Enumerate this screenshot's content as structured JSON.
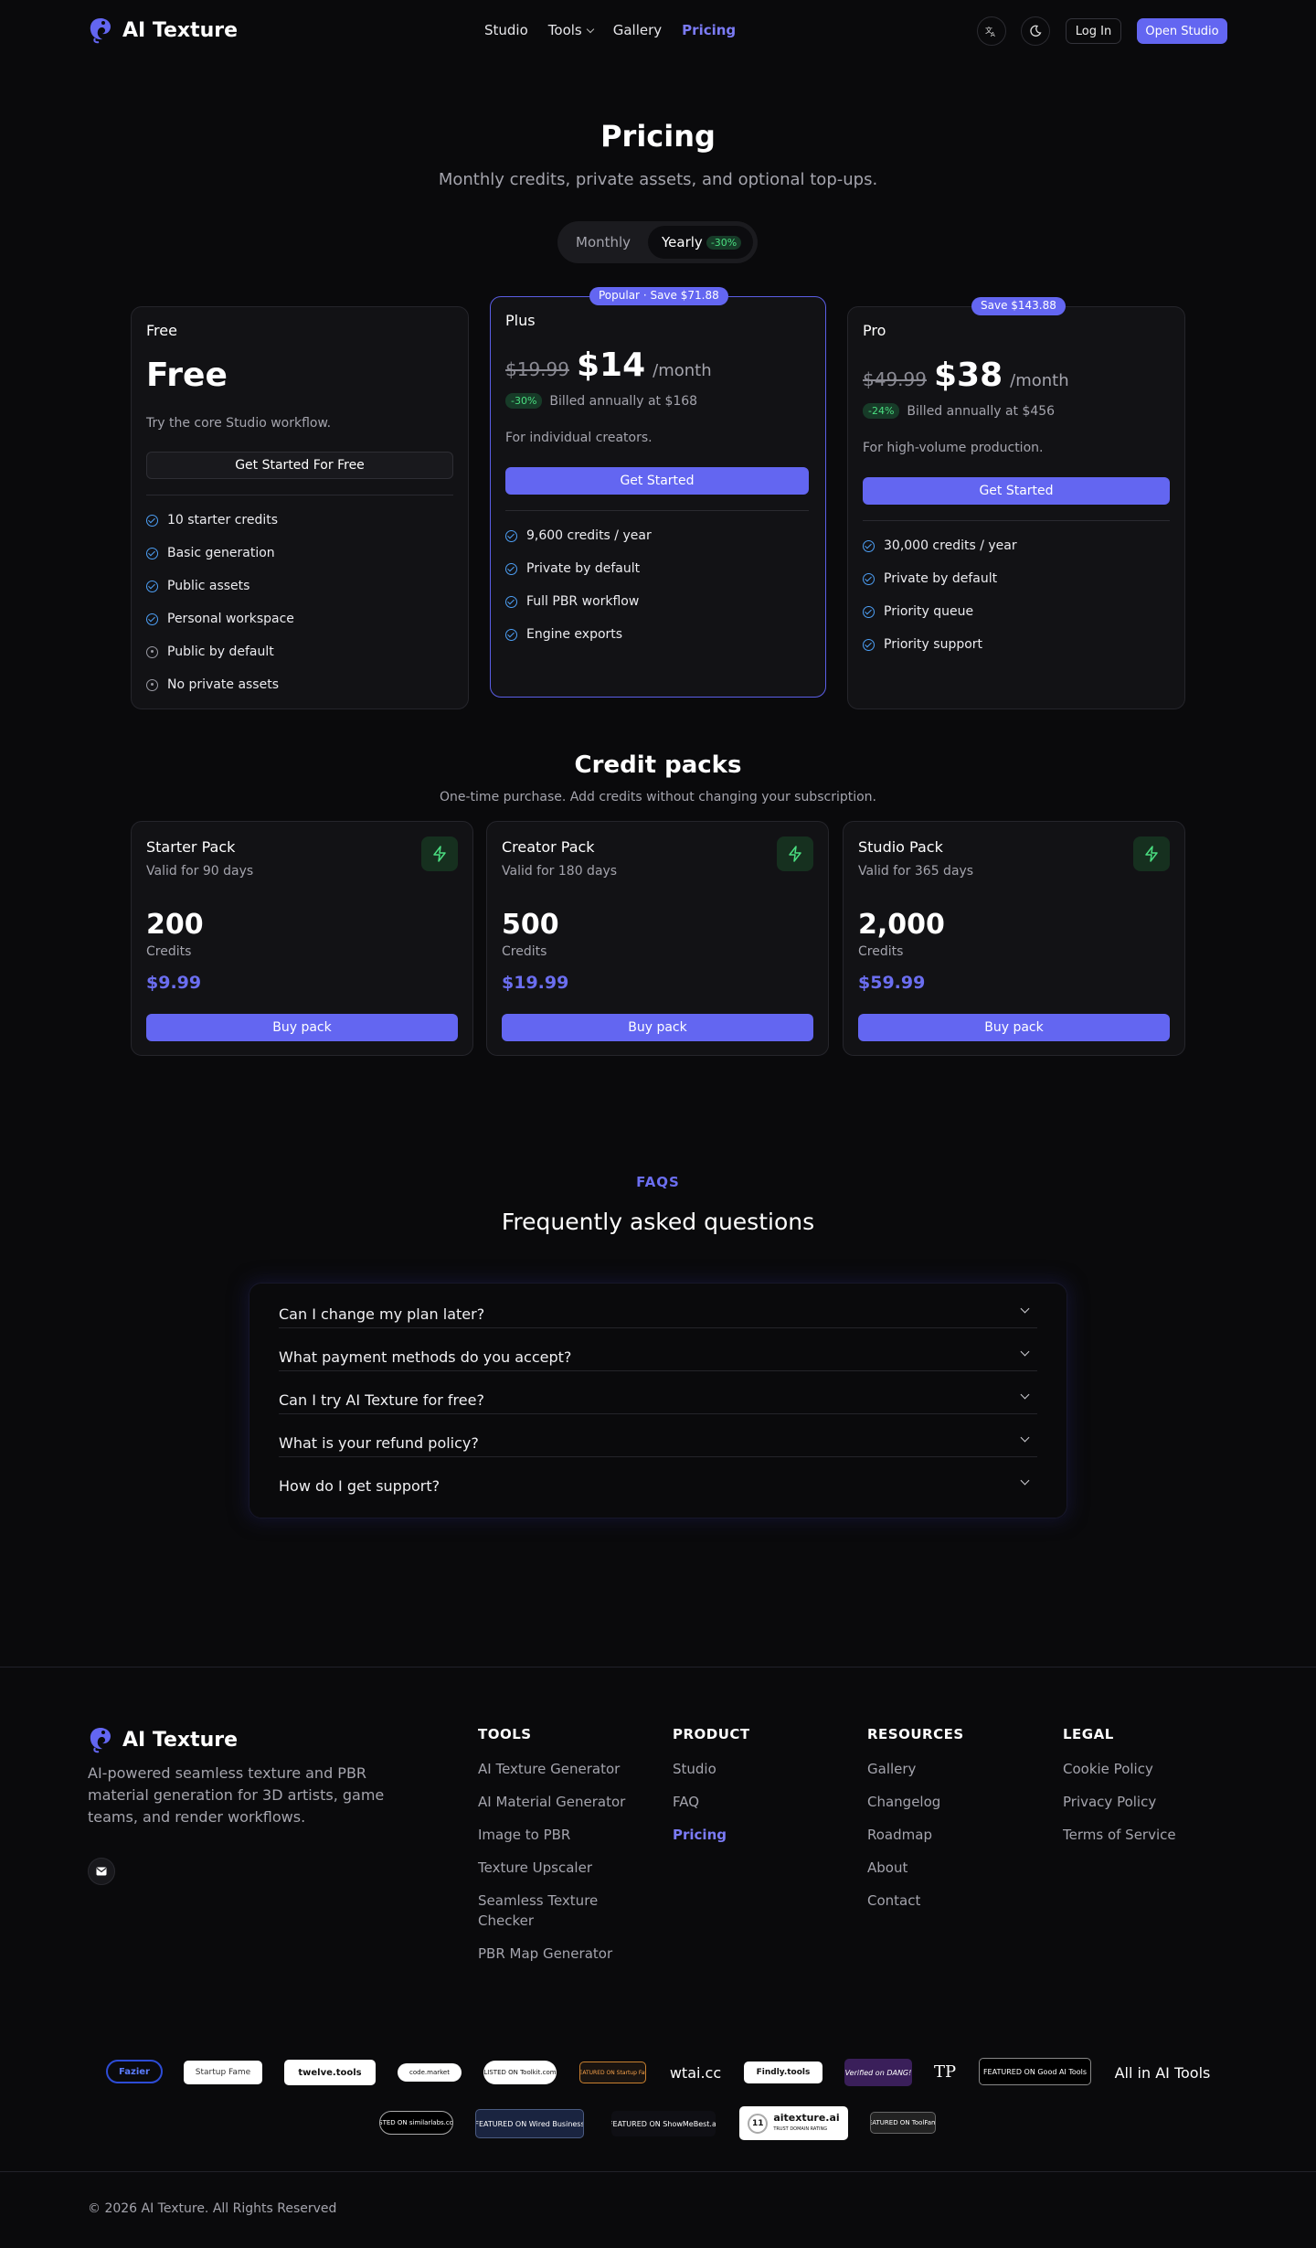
{
  "nav": {
    "brand": "AI Texture",
    "links": [
      "Studio",
      "Tools",
      "Gallery",
      "Pricing"
    ],
    "login": "Log In",
    "open_studio": "Open Studio",
    "translate_icon": "translate-icon",
    "theme_icon": "moon-icon"
  },
  "hero": {
    "title": "Pricing",
    "subtitle": "Monthly credits, private assets, and optional top-ups.",
    "billing_toggle": {
      "monthly": "Monthly",
      "yearly": "Yearly",
      "yearly_discount": "-30%",
      "selected": "Yearly"
    }
  },
  "plans": [
    {
      "name": "Free",
      "price": "Free",
      "description": "Try the core Studio workflow.",
      "cta": "Get Started For Free",
      "features": [
        {
          "text": "10 starter credits",
          "included": true
        },
        {
          "text": "Basic generation",
          "included": true
        },
        {
          "text": "Public assets",
          "included": true
        },
        {
          "text": "Personal workspace",
          "included": true
        },
        {
          "text": "Public by default",
          "included": false
        },
        {
          "text": "No private assets",
          "included": false
        }
      ]
    },
    {
      "name": "Plus",
      "badge_popular": "Popular",
      "badge_save": "Save $71.88",
      "old_price": "$19.99",
      "price": "$14",
      "period": "/month",
      "discount": "-30%",
      "billed": "Billed annually at $168",
      "description": "For individual creators.",
      "cta": "Get Started",
      "features": [
        {
          "text": "9,600 credits / year",
          "included": true
        },
        {
          "text": "Private by default",
          "included": true
        },
        {
          "text": "Full PBR workflow",
          "included": true
        },
        {
          "text": "Engine exports",
          "included": true
        }
      ]
    },
    {
      "name": "Pro",
      "badge_save": "Save $143.88",
      "old_price": "$49.99",
      "price": "$38",
      "period": "/month",
      "discount": "-24%",
      "billed": "Billed annually at $456",
      "description": "For high-volume production.",
      "cta": "Get Started",
      "features": [
        {
          "text": "30,000 credits / year",
          "included": true
        },
        {
          "text": "Private by default",
          "included": true
        },
        {
          "text": "Priority queue",
          "included": true
        },
        {
          "text": "Priority support",
          "included": true
        }
      ]
    }
  ],
  "credit_packs": {
    "title": "Credit packs",
    "subtitle": "One-time purchase. Add credits without changing your subscription.",
    "packs": [
      {
        "name": "Starter Pack",
        "validity": "Valid for 90 days",
        "credits": "200",
        "unit": "Credits",
        "price": "$9.99",
        "cta": "Buy pack"
      },
      {
        "name": "Creator Pack",
        "validity": "Valid for 180 days",
        "credits": "500",
        "unit": "Credits",
        "price": "$19.99",
        "cta": "Buy pack"
      },
      {
        "name": "Studio Pack",
        "validity": "Valid for 365 days",
        "credits": "2,000",
        "unit": "Credits",
        "price": "$59.99",
        "cta": "Buy pack"
      }
    ]
  },
  "faq": {
    "kicker": "FAQS",
    "title": "Frequently asked questions",
    "questions": [
      "Can I change my plan later?",
      "What payment methods do you accept?",
      "Can I try AI Texture for free?",
      "What is your refund policy?",
      "How do I get support?"
    ]
  },
  "footer": {
    "brand": "AI Texture",
    "description": "AI-powered seamless texture and PBR material generation for 3D artists, game teams, and render workflows.",
    "mail_icon": "mail-icon",
    "columns": [
      {
        "title": "TOOLS",
        "links": [
          "AI Texture Generator",
          "AI Material Generator",
          "Image to PBR",
          "Texture Upscaler",
          "Seamless Texture Checker",
          "PBR Map Generator"
        ]
      },
      {
        "title": "PRODUCT",
        "links": [
          "Studio",
          "FAQ",
          "Pricing"
        ]
      },
      {
        "title": "RESOURCES",
        "links": [
          "Gallery",
          "Changelog",
          "Roadmap",
          "About",
          "Contact"
        ]
      },
      {
        "title": "LEGAL",
        "links": [
          "Cookie Policy",
          "Privacy Policy",
          "Terms of Service"
        ]
      }
    ],
    "badges_row1": [
      "Fazier",
      "Startup Fame",
      "twelve.tools",
      "code.market",
      "LISTED ON Toolkit.com",
      "FEATURED ON Startup Fast",
      "wtai.cc",
      "Findly.tools",
      "Verified on DANG!",
      "TP",
      "FEATURED ON Good AI Tools",
      "All in AI Tools"
    ],
    "badges_row2": [
      "LISTED ON similarlabs.com",
      "FEATURED ON Wired Business",
      "FEATURED ON ShowMeBest.ai",
      "aitexture.ai",
      "FEATURED ON ToolFame"
    ],
    "aitexture_rating": "11",
    "aitexture_caption": "TRUST DOMAIN RATING",
    "copyright": "© 2026 AI Texture. All Rights Reserved"
  },
  "colors": {
    "accent": "#6366f1",
    "background": "#0a0a0c",
    "card": "#121215",
    "success": "#4ade80"
  }
}
